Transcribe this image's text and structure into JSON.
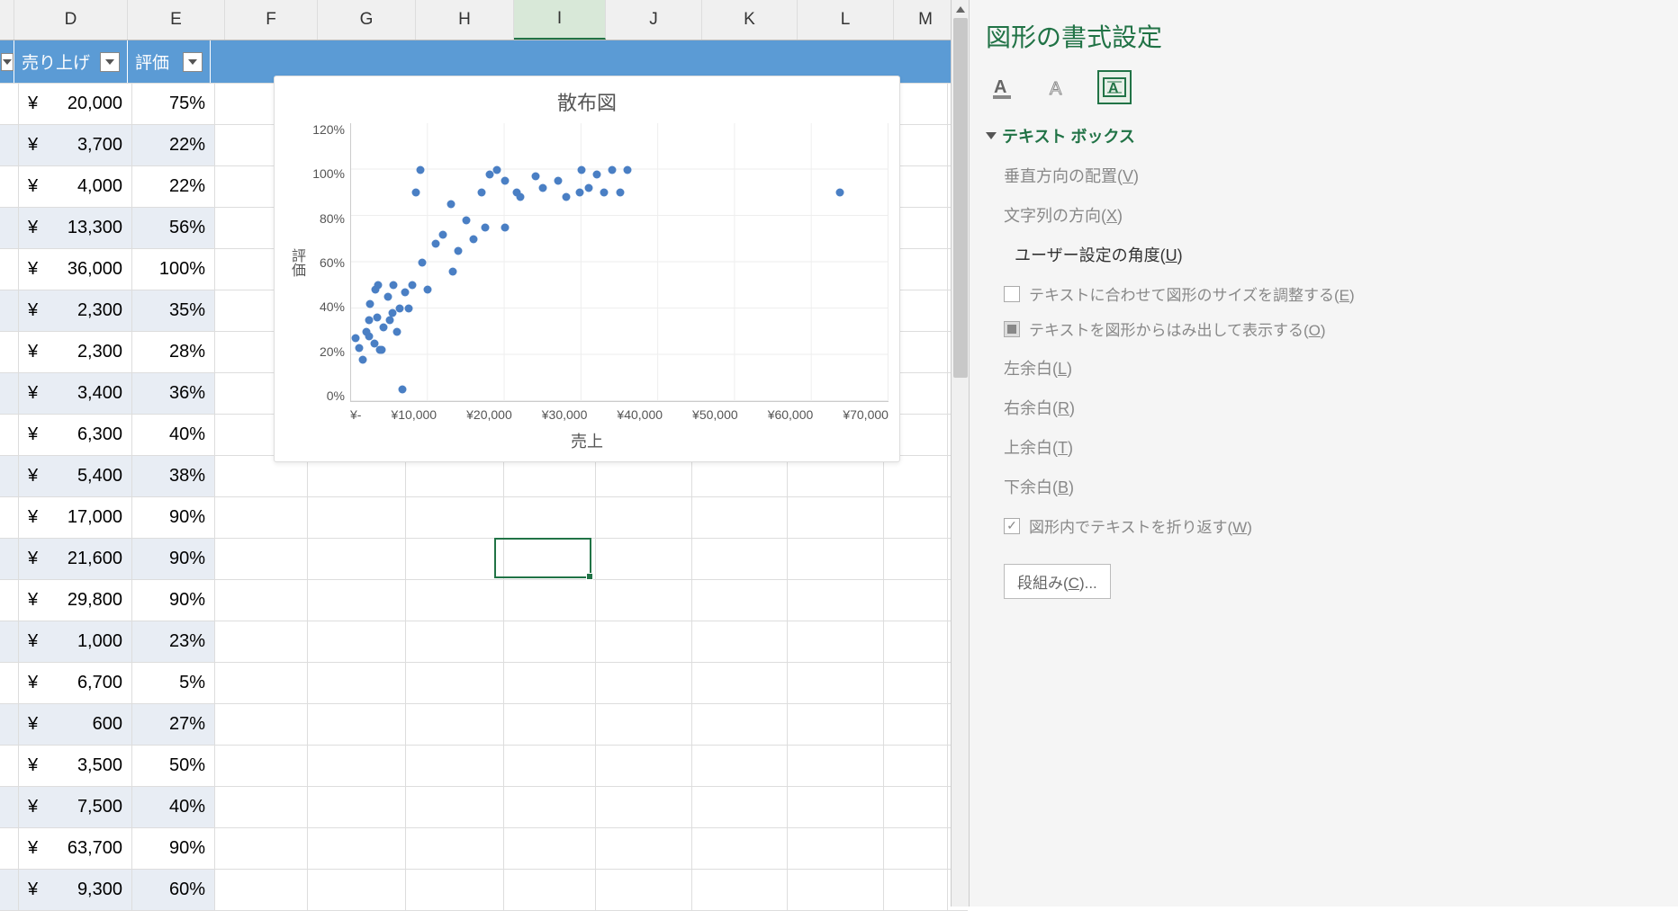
{
  "columns": [
    {
      "letter": "D",
      "width": 126
    },
    {
      "letter": "E",
      "width": 108
    },
    {
      "letter": "F",
      "width": 103
    },
    {
      "letter": "G",
      "width": 109
    },
    {
      "letter": "H",
      "width": 109
    },
    {
      "letter": "I",
      "width": 102
    },
    {
      "letter": "J",
      "width": 107
    },
    {
      "letter": "K",
      "width": 106
    },
    {
      "letter": "L",
      "width": 107
    },
    {
      "letter": "M",
      "width": 71
    }
  ],
  "selected_column": "I",
  "table_headers": {
    "d": "売り上げ",
    "e": "評価"
  },
  "rows": [
    {
      "sales": "20,000",
      "rating": "75%"
    },
    {
      "sales": "3,700",
      "rating": "22%"
    },
    {
      "sales": "4,000",
      "rating": "22%"
    },
    {
      "sales": "13,300",
      "rating": "56%"
    },
    {
      "sales": "36,000",
      "rating": "100%"
    },
    {
      "sales": "2,300",
      "rating": "35%"
    },
    {
      "sales": "2,300",
      "rating": "28%"
    },
    {
      "sales": "3,400",
      "rating": "36%"
    },
    {
      "sales": "6,300",
      "rating": "40%"
    },
    {
      "sales": "5,400",
      "rating": "38%"
    },
    {
      "sales": "17,000",
      "rating": "90%"
    },
    {
      "sales": "21,600",
      "rating": "90%"
    },
    {
      "sales": "29,800",
      "rating": "90%"
    },
    {
      "sales": "1,000",
      "rating": "23%"
    },
    {
      "sales": "6,700",
      "rating": "5%"
    },
    {
      "sales": "600",
      "rating": "27%"
    },
    {
      "sales": "3,500",
      "rating": "50%"
    },
    {
      "sales": "7,500",
      "rating": "40%"
    },
    {
      "sales": "63,700",
      "rating": "90%"
    },
    {
      "sales": "9,300",
      "rating": "60%"
    }
  ],
  "yen_symbol": "¥",
  "chart_data": {
    "type": "scatter",
    "title": "散布図",
    "xlabel": "売上",
    "ylabel": "評価",
    "xlim": [
      0,
      70000
    ],
    "ylim": [
      0,
      120
    ],
    "x_ticks": [
      "¥-",
      "¥10,000",
      "¥20,000",
      "¥30,000",
      "¥40,000",
      "¥50,000",
      "¥60,000",
      "¥70,000"
    ],
    "y_ticks": [
      "120%",
      "100%",
      "80%",
      "60%",
      "40%",
      "20%",
      "0%"
    ],
    "points": [
      [
        20000,
        75
      ],
      [
        3700,
        22
      ],
      [
        4000,
        22
      ],
      [
        13300,
        56
      ],
      [
        36000,
        100
      ],
      [
        2300,
        35
      ],
      [
        2300,
        28
      ],
      [
        3400,
        36
      ],
      [
        6300,
        40
      ],
      [
        5400,
        38
      ],
      [
        17000,
        90
      ],
      [
        21600,
        90
      ],
      [
        29800,
        90
      ],
      [
        1000,
        23
      ],
      [
        6700,
        5
      ],
      [
        600,
        27
      ],
      [
        3500,
        50
      ],
      [
        7500,
        40
      ],
      [
        63700,
        90
      ],
      [
        9300,
        60
      ],
      [
        1500,
        18
      ],
      [
        2000,
        30
      ],
      [
        2500,
        42
      ],
      [
        3000,
        25
      ],
      [
        3200,
        48
      ],
      [
        4200,
        32
      ],
      [
        4800,
        45
      ],
      [
        5000,
        35
      ],
      [
        5500,
        50
      ],
      [
        6000,
        30
      ],
      [
        7000,
        47
      ],
      [
        8000,
        50
      ],
      [
        8500,
        90
      ],
      [
        9000,
        100
      ],
      [
        10000,
        48
      ],
      [
        11000,
        68
      ],
      [
        12000,
        72
      ],
      [
        13000,
        85
      ],
      [
        14000,
        65
      ],
      [
        15000,
        78
      ],
      [
        16000,
        70
      ],
      [
        17500,
        75
      ],
      [
        18000,
        98
      ],
      [
        19000,
        100
      ],
      [
        20000,
        95
      ],
      [
        22000,
        88
      ],
      [
        24000,
        97
      ],
      [
        25000,
        92
      ],
      [
        27000,
        95
      ],
      [
        28000,
        88
      ],
      [
        30000,
        100
      ],
      [
        31000,
        92
      ],
      [
        32000,
        98
      ],
      [
        33000,
        90
      ],
      [
        34000,
        100
      ],
      [
        35000,
        90
      ]
    ]
  },
  "panel": {
    "title": "図形の書式設定",
    "section": "テキスト ボックス",
    "options": {
      "v_align": "垂直方向の配置(V)",
      "text_dir": "文字列の方向(X)",
      "user_angle": "ユーザー設定の角度(U)",
      "autofit": "テキストに合わせて図形のサイズを調整する(E)",
      "overflow": "テキストを図形からはみ出して表示する(O)",
      "margin_left": "左余白(L)",
      "margin_right": "右余白(R)",
      "margin_top": "上余白(T)",
      "margin_bottom": "下余白(B)",
      "wrap": "図形内でテキストを折り返す(W)",
      "columns_btn": "段組み(C)..."
    }
  }
}
